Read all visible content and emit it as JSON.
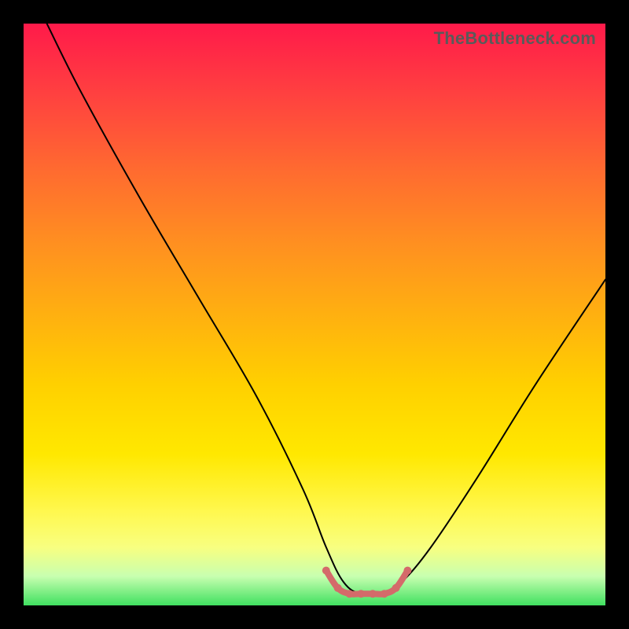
{
  "watermark": "TheBottleneck.com",
  "chart_data": {
    "type": "line",
    "title": "",
    "xlabel": "",
    "ylabel": "",
    "xlim": [
      0,
      100
    ],
    "ylim": [
      0,
      100
    ],
    "grid": false,
    "legend": false,
    "annotations": [],
    "series": [
      {
        "name": "primary-curve",
        "color": "#000000",
        "x": [
          4,
          10,
          20,
          30,
          40,
          48,
          52,
          55,
          58,
          62,
          65,
          70,
          78,
          88,
          100
        ],
        "y": [
          100,
          88,
          70,
          53,
          36,
          20,
          10,
          4,
          2,
          2,
          4,
          10,
          22,
          38,
          56
        ]
      },
      {
        "name": "highlight-floor",
        "color": "#d46a6a",
        "x": [
          52,
          54,
          56,
          58,
          60,
          62,
          64,
          66
        ],
        "y": [
          6,
          3,
          2,
          2,
          2,
          2,
          3,
          6
        ]
      }
    ]
  }
}
